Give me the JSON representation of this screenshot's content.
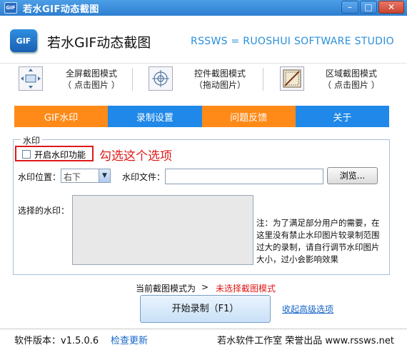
{
  "window": {
    "title": "若水GIF动态截图",
    "icon_text": "GIF",
    "buttons": [
      "minimize",
      "maximize",
      "close"
    ]
  },
  "header": {
    "logo_text": "GIF",
    "app_title": "若水GIF动态截图",
    "studio": "RSSWS = RUOSHUI SOFTWARE STUDIO"
  },
  "modes": [
    {
      "icon": "fullscreen-arrows-icon",
      "line1": "全屏截图模式",
      "line2": "（ 点击图片 ）"
    },
    {
      "icon": "crosshair-target-icon",
      "line1": "控件截图模式",
      "line2": "（拖动图片）"
    },
    {
      "icon": "region-select-icon",
      "line1": "区域截图模式",
      "line2": "（ 点击图片 ）"
    }
  ],
  "tabs": [
    {
      "label": "GIF水印",
      "color": "#ff8a18"
    },
    {
      "label": "录制设置",
      "color": "#1f88e8"
    },
    {
      "label": "问题反馈",
      "color": "#ff8a18"
    },
    {
      "label": "关于",
      "color": "#1f88e8"
    }
  ],
  "watermark": {
    "legend": "水印",
    "enable_label": "开启水印功能",
    "enable_checked": false,
    "annotation": "勾选这个选项",
    "position_label": "水印位置：",
    "position_value": "右下",
    "file_label": "水印文件：",
    "file_value": "",
    "browse_label": "浏览...",
    "preview_label": "选择的水印：",
    "note_lines": [
      "注：为了满足部分用户的需要，在",
      "这里没有禁止水印图片较录制范围",
      "过大的录制，请自行调节水印图片",
      "大小，过小会影响效果"
    ]
  },
  "status": {
    "label": "当前截图模式为",
    "arrow": ">",
    "value": "未选择截图模式"
  },
  "actions": {
    "start_label": "开始录制（F1）",
    "advanced_link": "收起高级选项"
  },
  "footer": {
    "version": "软件版本：v1.5.0.6",
    "check_update": "检查更新",
    "copyright": "若水软件工作室 荣誉出品 www.rssws.net"
  }
}
